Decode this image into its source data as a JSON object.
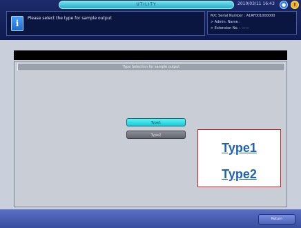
{
  "header": {
    "status_text": "UTILITY",
    "datetime": "2010/03/11 16:43",
    "message": "Please select the type for sample output",
    "info_lines": [
      "M/C Serial Number : A1RF001000000",
      "> Admin. Name :",
      "> Extension No. : ------"
    ]
  },
  "panel": {
    "title": "Type Selection for sample output",
    "buttons": [
      {
        "label": "Type1",
        "state": "selected"
      },
      {
        "label": "Type2",
        "state": "normal"
      }
    ]
  },
  "footer": {
    "return_label": "Return"
  },
  "overlay": {
    "items": [
      "Type1",
      "Type2"
    ]
  },
  "icons": {
    "info": "info-icon",
    "status_blue": "status-icon",
    "status_orange": "alert-icon"
  },
  "colors": {
    "accent": "#1bc9d6",
    "overlay_border": "#d12020",
    "link": "#1f62b5"
  }
}
